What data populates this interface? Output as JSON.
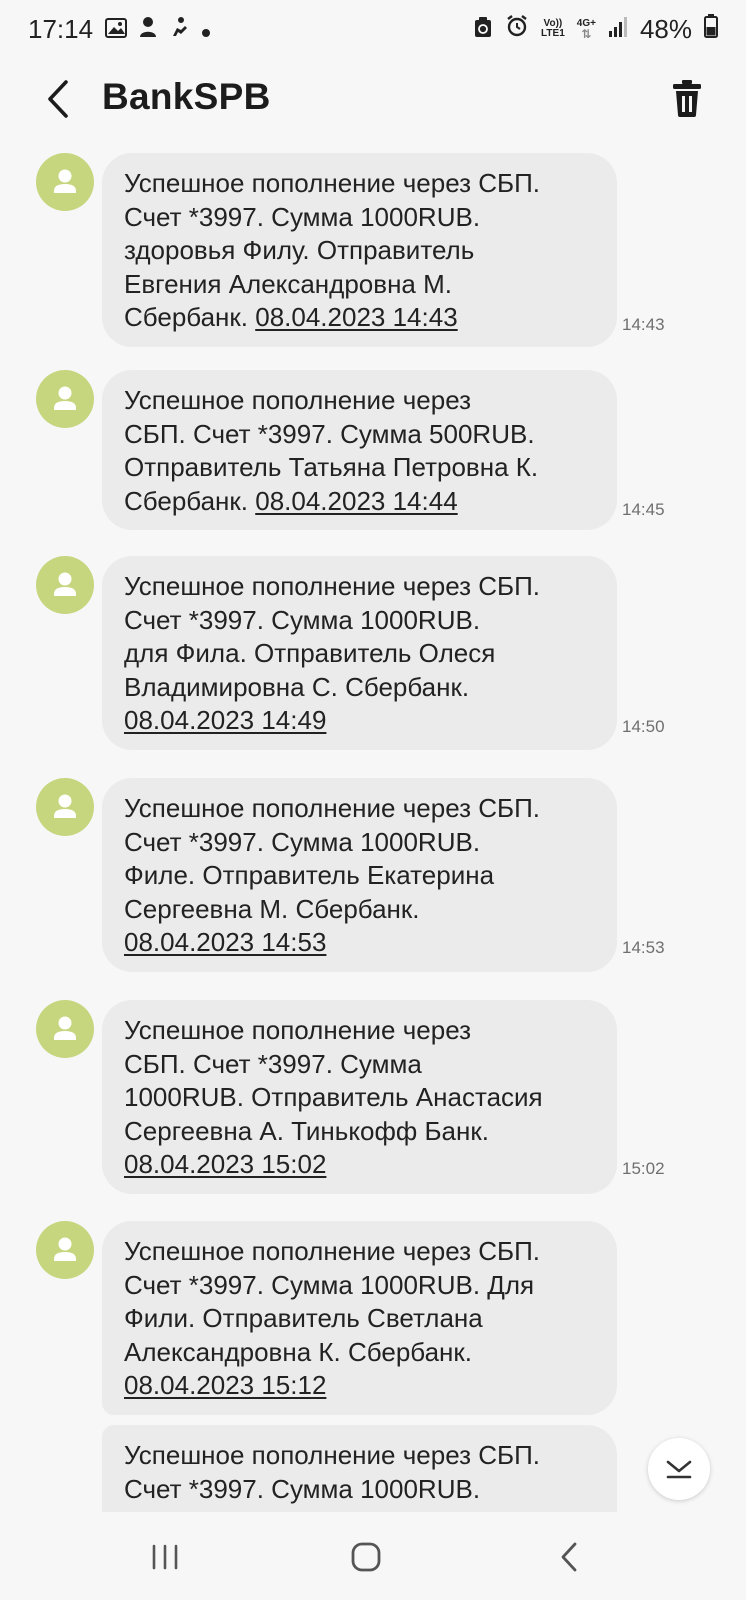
{
  "status_bar": {
    "time": "17:14",
    "volte_label": "Vo))",
    "lte_label": "LTE1",
    "network_label": "4G+",
    "battery": "48%"
  },
  "header": {
    "title": "BankSPB"
  },
  "messages": [
    {
      "lines": [
        "Успешное пополнение через СБП.",
        "Счет *3997. Сумма 1000RUB.",
        "здоровья Филу. Отправитель",
        "Евгения Александровна М."
      ],
      "prefix": "Сбербанк. ",
      "date": "08.04.2023 14:43",
      "time": "14:43"
    },
    {
      "lines": [
        "Успешное пополнение через",
        "СБП. Счет *3997. Сумма 500RUB.",
        "Отправитель Татьяна Петровна К."
      ],
      "prefix": "Сбербанк. ",
      "date": "08.04.2023 14:44",
      "time": "14:45"
    },
    {
      "lines": [
        "Успешное пополнение через СБП.",
        "Счет *3997. Сумма 1000RUB.",
        "для Фила. Отправитель Олеся",
        "Владимировна С. Сбербанк."
      ],
      "prefix": "",
      "date": "08.04.2023 14:49",
      "time": "14:50"
    },
    {
      "lines": [
        "Успешное пополнение через СБП.",
        "Счет *3997. Сумма 1000RUB.",
        "Филе. Отправитель Екатерина",
        "Сергеевна М. Сбербанк."
      ],
      "prefix": "",
      "date": "08.04.2023 14:53",
      "time": "14:53"
    },
    {
      "lines": [
        "Успешное пополнение через",
        "СБП. Счет *3997. Сумма",
        "1000RUB. Отправитель Анастасия",
        "Сергеевна А. Тинькофф Банк."
      ],
      "prefix": "",
      "date": "08.04.2023 15:02",
      "time": "15:02"
    },
    {
      "lines": [
        "Успешное пополнение через СБП.",
        "Счет *3997. Сумма 1000RUB. Для",
        "Фили. Отправитель Светлана",
        "Александровна К. Сбербанк."
      ],
      "prefix": "",
      "date": "08.04.2023 15:12",
      "time": ""
    },
    {
      "lines": [
        "Успешное пополнение через СБП.",
        "Счет *3997. Сумма 1000RUB."
      ],
      "prefix": "",
      "date": "",
      "time": ""
    }
  ]
}
